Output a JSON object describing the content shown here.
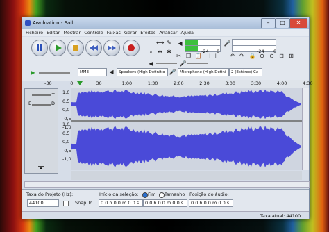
{
  "window": {
    "title": "Awolnation - Sail"
  },
  "menu": [
    "Ficheiro",
    "Editar",
    "Mostrar",
    "Controle",
    "Faixas",
    "Gerar",
    "Efeitos",
    "Analisar",
    "Ajuda"
  ],
  "meter": {
    "rec_scale_a": "-24",
    "rec_scale_b": "0",
    "play_level": 0.35,
    "rec_level": 0.0
  },
  "devices": {
    "host": "MME",
    "playback": "Speakers (High Definitio",
    "recording": "Microphone (High Defini",
    "channels": "2 (Estéreo) Ca"
  },
  "timeline": {
    "ticks": [
      "-30",
      "0",
      "30",
      "1:00",
      "1:30",
      "2:00",
      "2:30",
      "3:00",
      "3:30",
      "4:00",
      "4:30"
    ]
  },
  "track": {
    "scale_top": [
      "1,0",
      "0,5",
      "0,0",
      "-0,5",
      "-1,0"
    ],
    "scale_bottom": [
      "1,0",
      "0,5",
      "0,0",
      "-0,5",
      "-1,0"
    ],
    "slider_minus": "-",
    "slider_plus": "+",
    "pan_l": "E",
    "pan_r": "D"
  },
  "colors": {
    "waveform": "#4a4ad8",
    "wave_bg": "#6060d0"
  },
  "selection": {
    "rate_label": "Taxa do Projeto (Hz):",
    "rate_value": "44100",
    "snap_label": "Snap To",
    "start_label": "Início da seleção:",
    "end_label": "Fim",
    "length_label": "Tamanho",
    "audio_pos_label": "Posição do áudio:",
    "start_value": "0 0 h 0 0 m 0 0 s",
    "end_value": "0 0 h 0 0 m 0 0 s",
    "audio_pos_value": "0 0 h 0 0 m 0 0 s"
  },
  "status": {
    "actual_rate": "Taxa atual: 44100"
  }
}
